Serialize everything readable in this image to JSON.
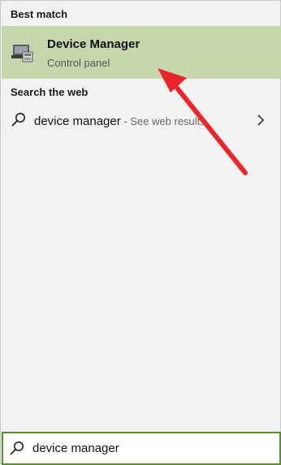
{
  "sections": {
    "best_match_header": "Best match",
    "web_header": "Search the web"
  },
  "best_match": {
    "title": "Device Manager",
    "subtitle": "Control panel",
    "icon": "device-manager-icon",
    "highlight_color": "#c6d6ad"
  },
  "web_result": {
    "query": "device manager",
    "hint": " - See web results",
    "icon": "search-icon",
    "chevron": "chevron-right-icon"
  },
  "annotation": {
    "arrow_color": "#e8262b"
  },
  "search_box": {
    "value": "device manager",
    "icon": "search-icon",
    "border_color": "#5a8f2d"
  }
}
